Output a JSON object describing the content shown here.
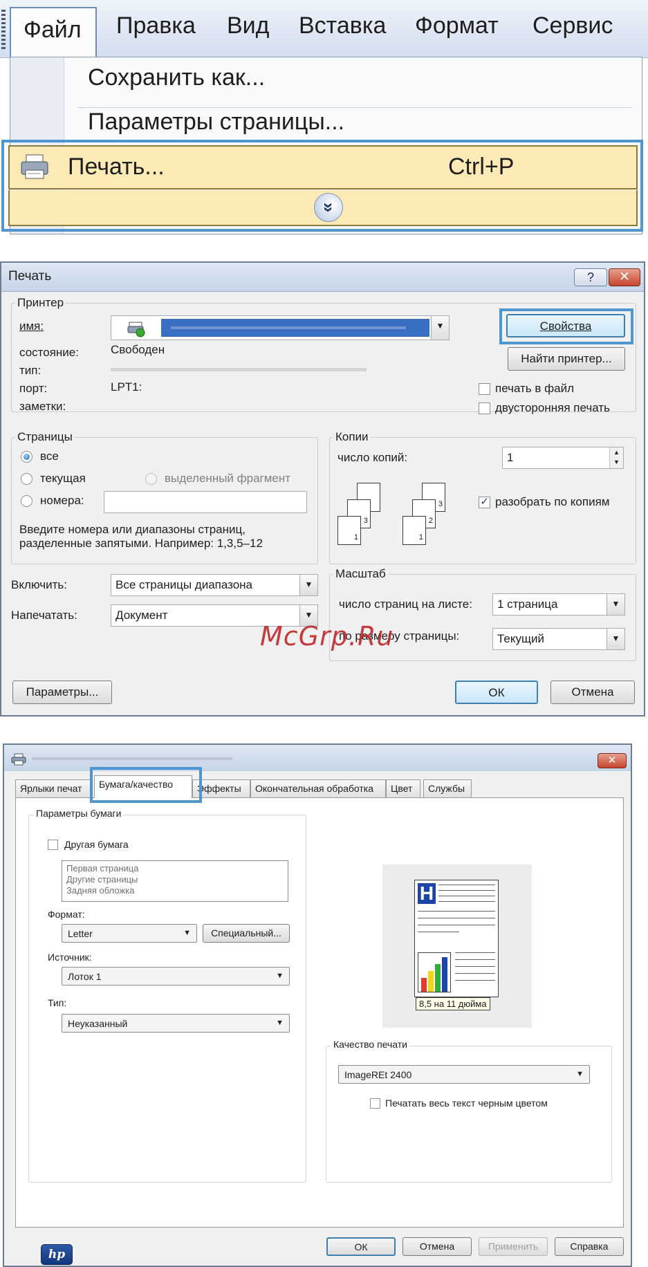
{
  "menu": {
    "items": [
      "Файл",
      "Правка",
      "Вид",
      "Вставка",
      "Формат",
      "Сервис"
    ],
    "dropdown": {
      "save_as": "Сохранить как...",
      "page_setup": "Параметры страницы...",
      "print": "Печать...",
      "print_shortcut": "Ctrl+P",
      "expand_glyph": "»"
    }
  },
  "print_dialog": {
    "title": "Печать",
    "help_glyph": "?",
    "close_glyph": "✕",
    "printer": {
      "group": "Принтер",
      "name_label": "имя:",
      "status_label": "состояние:",
      "status_value": "Свободен",
      "type_label": "тип:",
      "port_label": "порт:",
      "port_value": "LPT1:",
      "notes_label": "заметки:",
      "properties_button": "Свойства",
      "find_button": "Найти принтер...",
      "print_to_file": "печать в файл",
      "duplex": "двусторонняя печать"
    },
    "pages": {
      "group": "Страницы",
      "all": "все",
      "current": "текущая",
      "selection": "выделенный фрагмент",
      "numbers": "номера:",
      "hint_line1": "Введите номера или диапазоны страниц,",
      "hint_line2": "разделенные запятыми. Например: 1,3,5–12"
    },
    "copies": {
      "group": "Копии",
      "count_label": "число копий:",
      "count_value": "1",
      "collate": "разобрать по копиям",
      "page_numbers": [
        "1",
        "2",
        "3"
      ]
    },
    "include_label": "Включить:",
    "include_value": "Все страницы диапазона",
    "print_what_label": "Напечатать:",
    "print_what_value": "Документ",
    "scale": {
      "group": "Масштаб",
      "pages_per_sheet_label": "число страниц на листе:",
      "pages_per_sheet_value": "1 страница",
      "fit_label": "по размеру страницы:",
      "fit_value": "Текущий"
    },
    "options_button": "Параметры...",
    "ok_button": "ОК",
    "cancel_button": "Отмена",
    "watermark": "McGrp.Ru"
  },
  "props_dialog": {
    "close_glyph": "✕",
    "tabs": [
      "Ярлыки печат",
      "Бумага/качество",
      "Эффекты",
      "Окончательная обработка",
      "Цвет",
      "Службы"
    ],
    "paper": {
      "group": "Параметры бумаги",
      "other_paper": "Другая бумага",
      "list": [
        "Первая страница",
        "Другие страницы",
        "Задняя обложка"
      ],
      "format_label": "Формат:",
      "format_value": "Letter",
      "custom_button": "Специальный...",
      "source_label": "Источник:",
      "source_value": "Лоток 1",
      "type_label": "Тип:",
      "type_value": "Неуказанный"
    },
    "preview_caption": "8,5 на 11 дюйма",
    "preview_letter": "H",
    "quality": {
      "group": "Качество печати",
      "value": "ImageREt 2400",
      "black_text": "Печатать весь текст черным цветом"
    },
    "hp_logo": "hp",
    "buttons": {
      "ok": "ОК",
      "cancel": "Отмена",
      "apply": "Применить",
      "help": "Справка"
    }
  }
}
